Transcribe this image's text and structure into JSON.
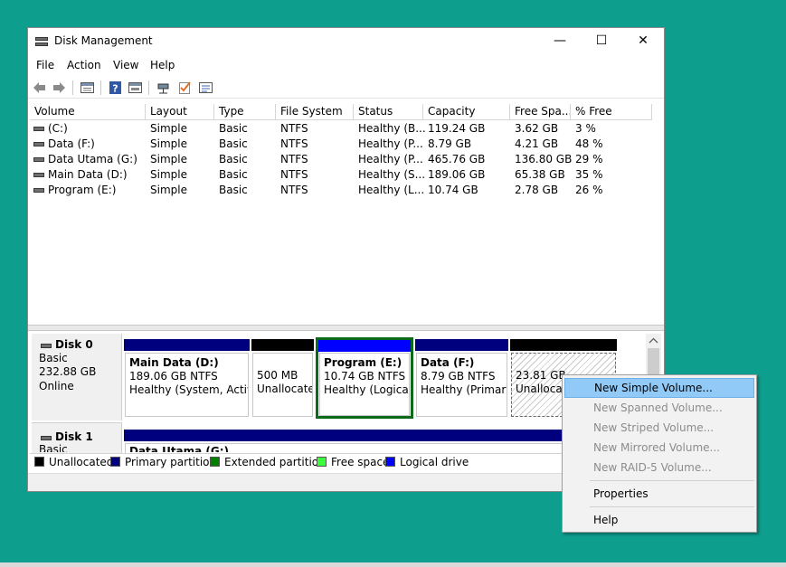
{
  "window": {
    "title": "Disk Management",
    "minimize_glyph": "—",
    "maximize_glyph": "☐",
    "close_glyph": "✕"
  },
  "menu": [
    "File",
    "Action",
    "View",
    "Help"
  ],
  "toolbar": {
    "icons": [
      "back-icon",
      "forward-icon",
      "disk-list-icon",
      "help-icon",
      "disk-view-icon",
      "connect-icon",
      "check-icon",
      "properties-icon"
    ]
  },
  "table": {
    "columns": [
      "Volume",
      "Layout",
      "Type",
      "File System",
      "Status",
      "Capacity",
      "Free Spa...",
      "% Free"
    ],
    "rows": [
      [
        "(C:)",
        "Simple",
        "Basic",
        "NTFS",
        "Healthy (B...",
        "119.24 GB",
        "3.62 GB",
        "3 %"
      ],
      [
        "Data (F:)",
        "Simple",
        "Basic",
        "NTFS",
        "Healthy (P...",
        "8.79 GB",
        "4.21 GB",
        "48 %"
      ],
      [
        "Data Utama (G:)",
        "Simple",
        "Basic",
        "NTFS",
        "Healthy (P...",
        "465.76 GB",
        "136.80 GB",
        "29 %"
      ],
      [
        "Main Data (D:)",
        "Simple",
        "Basic",
        "NTFS",
        "Healthy (S...",
        "189.06 GB",
        "65.38 GB",
        "35 %"
      ],
      [
        "Program (E:)",
        "Simple",
        "Basic",
        "NTFS",
        "Healthy (L...",
        "10.74 GB",
        "2.78 GB",
        "26 %"
      ]
    ]
  },
  "disk0": {
    "name": "Disk 0",
    "type": "Basic",
    "size": "232.88 GB",
    "state": "Online",
    "partitions": [
      {
        "name": "Main Data  (D:)",
        "line2": "189.06 GB NTFS",
        "line3": "Healthy (System, Active",
        "color": "#00007f"
      },
      {
        "name": "",
        "line2": "500 MB",
        "line3": "Unallocate",
        "color": "#000000"
      },
      {
        "name": "Program  (E:)",
        "line2": "10.74 GB NTFS",
        "line3": "Healthy (Logica",
        "color": "#0000ff"
      },
      {
        "name": "Data  (F:)",
        "line2": "8.79 GB NTFS",
        "line3": "Healthy (Primary",
        "color": "#00007f"
      },
      {
        "name": "",
        "line2": "23.81 GB",
        "line3": "Unallocat",
        "color": "#000000"
      }
    ]
  },
  "disk1": {
    "name": "Disk 1",
    "type": "Basic",
    "partition_name": "Data Utama (G:)"
  },
  "legend": [
    {
      "label": "Unallocated",
      "color": "#000000"
    },
    {
      "label": "Primary partition",
      "color": "#00007f"
    },
    {
      "label": "Extended partition",
      "color": "#007f00"
    },
    {
      "label": "Free space",
      "color": "#3aff3a"
    },
    {
      "label": "Logical drive",
      "color": "#0000ff"
    }
  ],
  "context_menu": {
    "items": [
      {
        "label": "New Simple Volume...",
        "state": "highlighted"
      },
      {
        "label": "New Spanned Volume...",
        "state": "disabled"
      },
      {
        "label": "New Striped Volume...",
        "state": "disabled"
      },
      {
        "label": "New Mirrored Volume...",
        "state": "disabled"
      },
      {
        "label": "New RAID-5 Volume...",
        "state": "disabled"
      },
      {
        "label": "Properties",
        "state": "enabled"
      },
      {
        "label": "Help",
        "state": "enabled"
      }
    ]
  }
}
